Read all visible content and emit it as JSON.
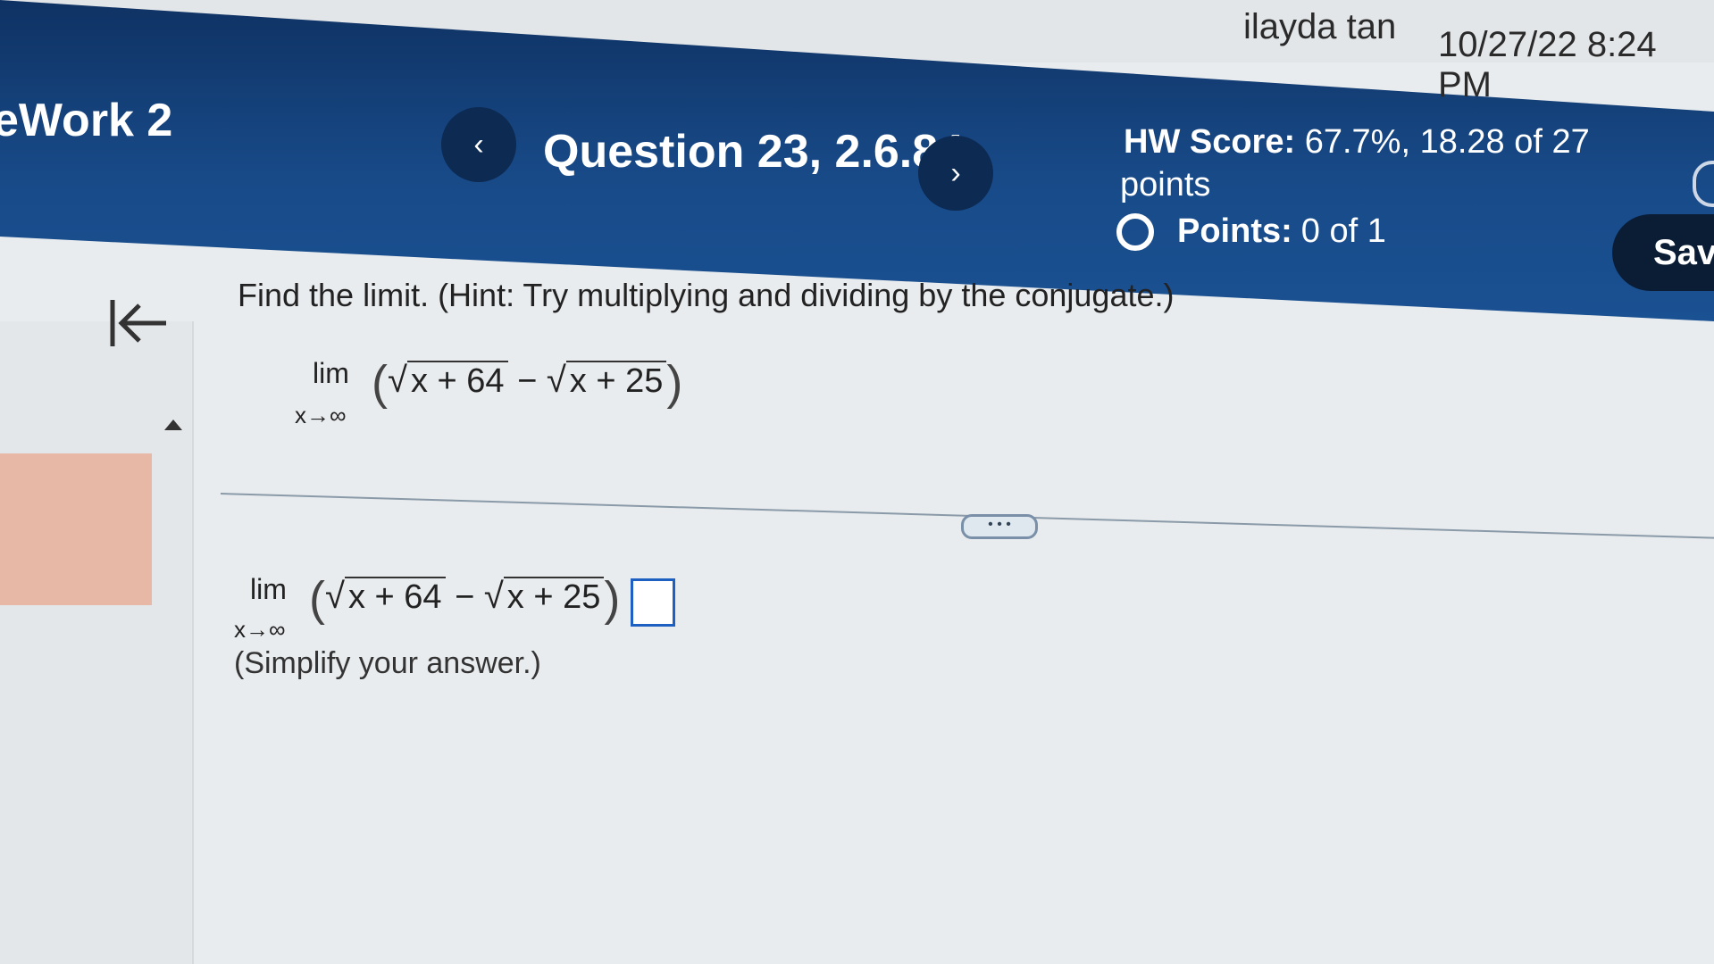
{
  "header": {
    "app_title": "eWork 2",
    "question_title": "Question 23, 2.6.84",
    "prev_label": "‹",
    "next_label": "›",
    "hw_score_label": "HW Score:",
    "hw_score_value": "67.7%, 18.28 of 27",
    "hw_score_unit": "points",
    "points_label": "Points:",
    "points_value": "0 of 1",
    "save_label": "Sav"
  },
  "user": {
    "name": "ilayda tan",
    "datetime": "10/27/22 8:24 PM"
  },
  "question": {
    "instruction": "Find the limit. (Hint: Try multiplying and dividing by the conjugate.)",
    "lim_word": "lim",
    "lim_sub": "x→∞",
    "radicand1": "x + 64",
    "minus": "−",
    "radicand2": "x + 25",
    "equals": "=",
    "more_label": "• • •",
    "simplify_hint": "(Simplify your answer.)"
  },
  "icons": {
    "collapse": "collapse-left-icon",
    "radio": "status-circle-icon",
    "settings": "gear-icon"
  }
}
